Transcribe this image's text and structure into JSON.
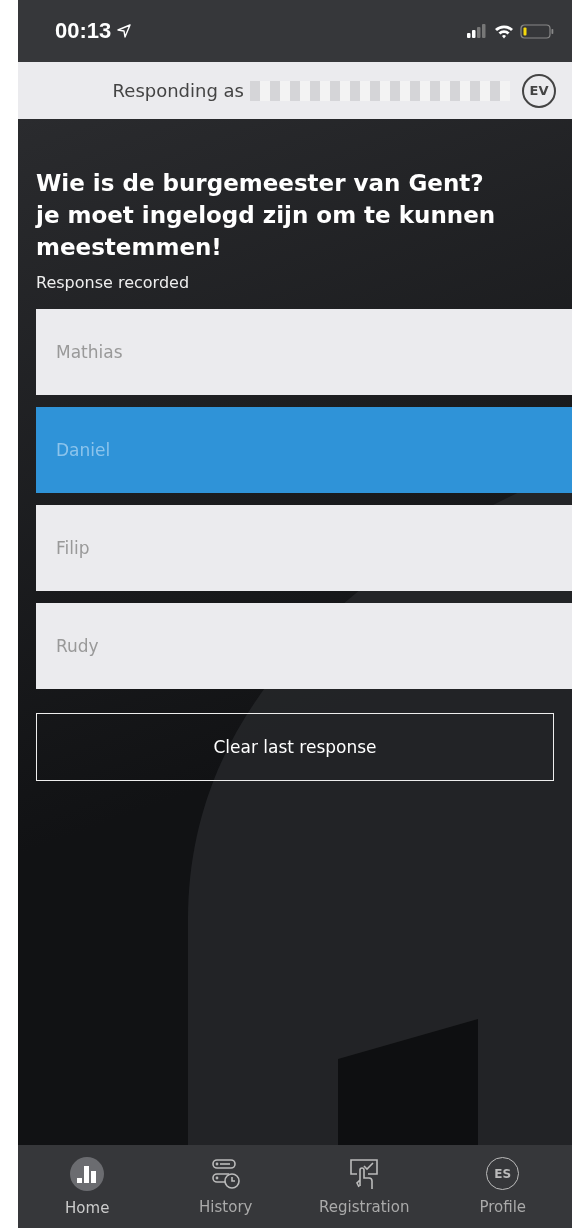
{
  "status_bar": {
    "time": "00:13"
  },
  "header": {
    "text": "Responding as",
    "avatar": "EV"
  },
  "question": {
    "title": "Wie is de burgemeester van Gent?\nje moet ingelogd zijn om te kunnen meestemmen!",
    "status": "Response recorded"
  },
  "options": [
    {
      "label": "Mathias",
      "selected": false
    },
    {
      "label": "Daniel",
      "selected": true
    },
    {
      "label": "Filip",
      "selected": false
    },
    {
      "label": "Rudy",
      "selected": false
    }
  ],
  "clear_button": "Clear last response",
  "tabs": [
    {
      "label": "Home",
      "kind": "home",
      "selected": true
    },
    {
      "label": "History",
      "kind": "history",
      "selected": false
    },
    {
      "label": "Registration",
      "kind": "registration",
      "selected": false
    },
    {
      "label": "Profile",
      "kind": "profile",
      "selected": false,
      "initials": "ES"
    }
  ]
}
